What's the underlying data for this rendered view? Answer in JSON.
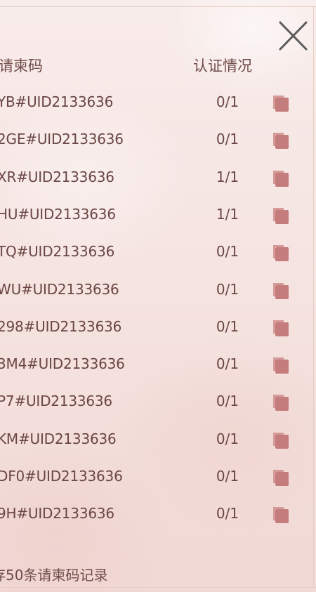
{
  "header": {
    "code_label": "请柬码",
    "status_label": "认证情况"
  },
  "rows": [
    {
      "code": "YB#UID2133636",
      "status": "0/1"
    },
    {
      "code": "2GE#UID2133636",
      "status": "0/1"
    },
    {
      "code": "XR#UID2133636",
      "status": "1/1"
    },
    {
      "code": "HU#UID2133636",
      "status": "1/1"
    },
    {
      "code": "TQ#UID2133636",
      "status": "0/1"
    },
    {
      "code": "WU#UID2133636",
      "status": "0/1"
    },
    {
      "code": "298#UID2133636",
      "status": "0/1"
    },
    {
      "code": "3M4#UID2133636",
      "status": "0/1"
    },
    {
      "code": "P7#UID2133636",
      "status": "0/1"
    },
    {
      "code": "KM#UID2133636",
      "status": "0/1"
    },
    {
      "code": "DF0#UID2133636",
      "status": "0/1"
    },
    {
      "code": "9H#UID2133636",
      "status": "0/1"
    }
  ],
  "footer": {
    "note": "存50条请柬码记录"
  },
  "icons": {
    "close": "close-icon",
    "copy": "copy-icon"
  },
  "colors": {
    "text": "#6a4644",
    "copy_icon": "#c47c7c",
    "close_icon": "#5b5b5b",
    "frame": "#e6cfc4"
  }
}
